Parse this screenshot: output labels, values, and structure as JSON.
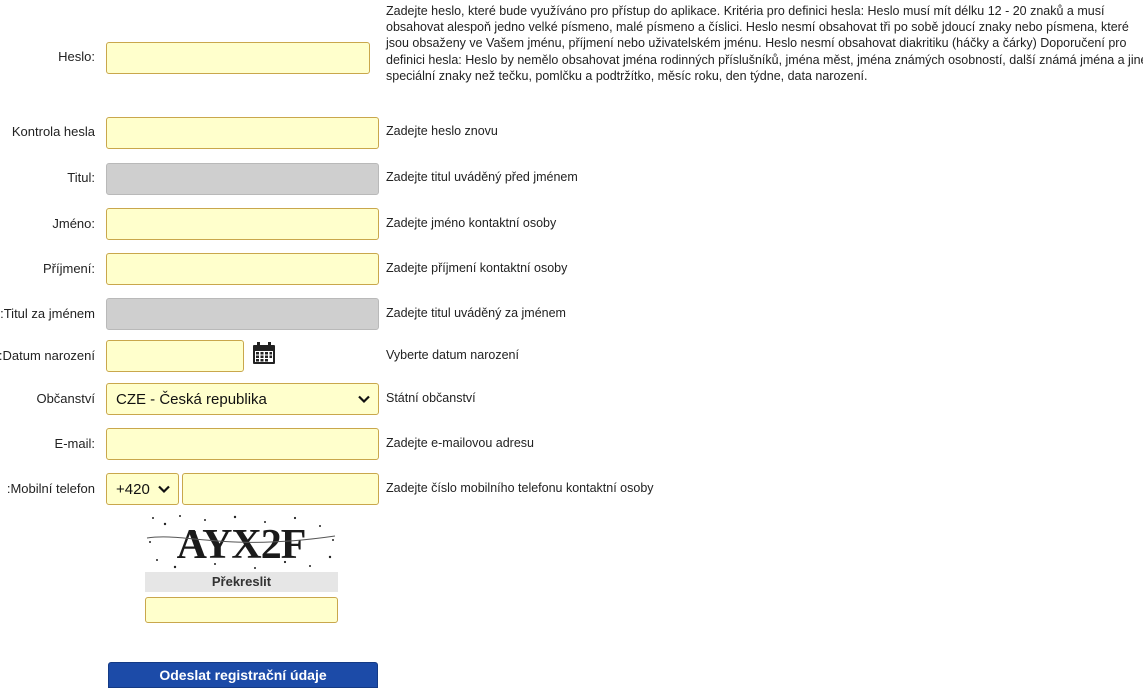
{
  "password": {
    "label": "Heslo:",
    "hint_lines": [
      "Zadejte heslo, které bude využíváno pro přístup do aplikace. Kritéria pro definici hesla: Heslo musí mít délku 12 - 20 znaků a musí",
      "obsahovat alespoň jedno velké písmeno, malé písmeno a číslici. Heslo nesmí obsahovat tři po sobě jdoucí znaky nebo písmena, které",
      "jsou obsaženy ve Vašem jménu, příjmení nebo uživatelském jménu. Heslo nesmí obsahovat diakritiku (háčky a čárky) Doporučení pro",
      "definici hesla: Heslo by nemělo obsahovat jména rodinných příslušníků, jména měst, jména známých osobností, další známá jména a jiné",
      "speciální znaky než tečku, pomlčku a podtržítko, měsíc roku, den týdne, data narození."
    ]
  },
  "password_check": {
    "label": "Kontrola hesla",
    "hint": "Zadejte heslo znovu"
  },
  "title_before": {
    "label": "Titul:",
    "hint": "Zadejte titul uváděný před jménem"
  },
  "first_name": {
    "label": "Jméno:",
    "hint": "Zadejte jméno kontaktní osoby"
  },
  "last_name": {
    "label": "Příjmení:",
    "hint": "Zadejte příjmení kontaktní osoby"
  },
  "title_after": {
    "label": "Titul za jménem:",
    "hint": "Zadejte titul uváděný za jménem"
  },
  "birth_date": {
    "label": "Datum narození:",
    "hint": "Vyberte datum narození",
    "icon": "calendar-icon"
  },
  "citizenship": {
    "label": "Občanství",
    "selected": "CZE - Česká republika",
    "hint": "Státní občanství"
  },
  "email": {
    "label": "E-mail:",
    "hint": "Zadejte e-mailovou adresu"
  },
  "mobile": {
    "label": "Mobilní telefon:",
    "prefix": "+420",
    "hint": "Zadejte číslo mobilního telefonu kontaktní osoby"
  },
  "captcha": {
    "text": "AYX2F",
    "redraw_label": "Překreslit"
  },
  "submit_label": "Odeslat registrační údaje",
  "colors": {
    "field_bg": "#ffffcc",
    "field_border": "#c9a74c",
    "disabled_bg": "#cfcfcf",
    "button": "#1c4ba8"
  }
}
